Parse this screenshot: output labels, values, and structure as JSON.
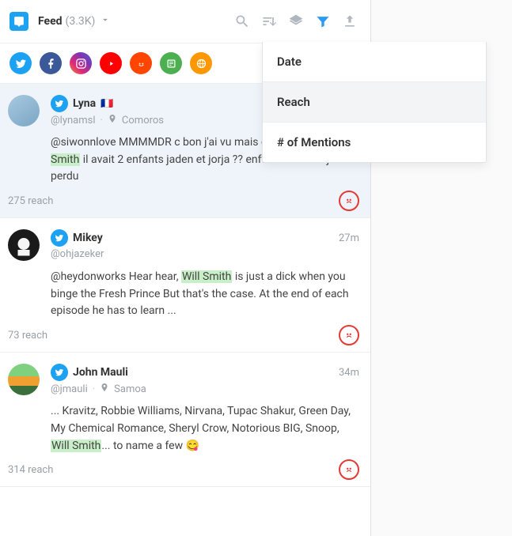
{
  "header": {
    "title": "Feed",
    "count": "(3.3K)"
  },
  "dropdown": {
    "items": [
      {
        "label": "Date",
        "selected": false
      },
      {
        "label": "Reach",
        "selected": true
      },
      {
        "label": "# of Mentions",
        "selected": false
      }
    ]
  },
  "socials": [
    {
      "name": "twitter",
      "color": "#1da1f2"
    },
    {
      "name": "facebook",
      "color": "#3b5998"
    },
    {
      "name": "instagram",
      "color": "linear-gradient(45deg,#f58529,#dd2a7b,#8134af,#515bd4)"
    },
    {
      "name": "youtube",
      "color": "#ff0000"
    },
    {
      "name": "reddit",
      "color": "#ff4500"
    },
    {
      "name": "news",
      "color": "#4caf50"
    },
    {
      "name": "web",
      "color": "#ff9800"
    }
  ],
  "posts": [
    {
      "active": true,
      "display_name": "Lyna",
      "flag": "🇫🇷",
      "handle": "@lynamsl",
      "location": "Comoros",
      "time": "",
      "body_pre": "@siwonnlove MMMMDR c bon j'ai vu mais dans ma tête ",
      "highlight1": "will Smith",
      "body_mid": " il avait 2 enfants jaden et jorja ?? enft rien à voir ? jss perdu",
      "highlight2": "",
      "body_post": "",
      "reach": "275 reach",
      "sentiment": "negative"
    },
    {
      "active": false,
      "display_name": "Mikey",
      "flag": "",
      "handle": "@ohjazeker",
      "location": "",
      "time": "27m",
      "body_pre": "@heydonworks Hear hear, ",
      "highlight1": "Will Smith",
      "body_mid": " is just a dick when you binge the Fresh Prince But that's the case. At the end of each episode he has to learn ...",
      "highlight2": "",
      "body_post": "",
      "reach": "73 reach",
      "sentiment": "negative"
    },
    {
      "active": false,
      "display_name": "John Mauli",
      "flag": "",
      "handle": "@jmauli",
      "location": "Samoa",
      "time": "34m",
      "body_pre": "... Kravitz, Robbie Williams, Nirvana, Tupac Shakur, Green Day, My Chemical Romance, Sheryl Crow, Notorious BIG, Snoop, ",
      "highlight1": "Will Smith",
      "body_mid": "... to name a few 😋",
      "highlight2": "",
      "body_post": "",
      "reach": "314 reach",
      "sentiment": "negative"
    }
  ]
}
